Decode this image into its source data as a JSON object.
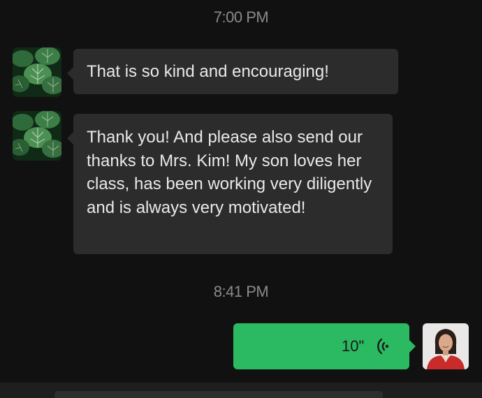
{
  "timestamps": {
    "first": "7:00 PM",
    "second": "8:41 PM"
  },
  "messages": [
    {
      "sender": "contact",
      "avatar": "monstera-leaves-avatar",
      "text": "That is so kind and encouraging!"
    },
    {
      "sender": "contact",
      "avatar": "monstera-leaves-avatar",
      "text": "Thank you! And please also send our thanks to Mrs. Kim! My son loves her class, has been working very diligently and is always very motivated!"
    }
  ],
  "voice_message": {
    "sender": "me",
    "duration": "10\"",
    "icon": "voice-wave-icon",
    "avatar": "profile-photo-avatar"
  },
  "colors": {
    "background": "#111111",
    "incoming_bubble": "#2c2c2c",
    "outgoing_bubble": "#2bb962",
    "timestamp_text": "#8a8a8a"
  }
}
